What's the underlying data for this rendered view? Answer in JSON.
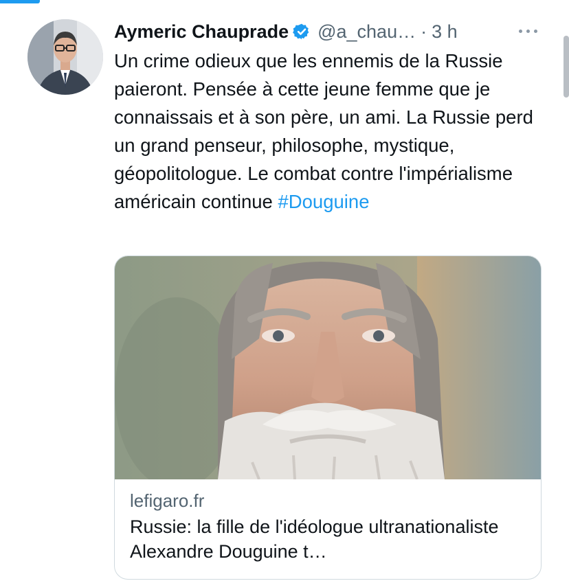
{
  "tweet": {
    "author_name": "Aymeric Chauprade",
    "handle": "@a_chau…",
    "separator": "·",
    "time": "3 h",
    "text_before_hashtag": "Un crime odieux que les ennemis de la Russie paieront. Pensée à cette jeune femme que je connaissais et à son père, un ami. La Russie perd un grand penseur, philosophe, mystique, géopolitologue. Le combat contre l'impérialisme américain continue ",
    "hashtag": "#Douguine"
  },
  "link_card": {
    "domain": "lefigaro.fr",
    "title": "Russie: la fille de l'idéologue ultranationaliste Alexandre Douguine t…"
  },
  "icons": {
    "verified": "verified-badge-icon",
    "more": "more-options-icon"
  },
  "colors": {
    "accent": "#1d9bf0",
    "text_primary": "#0f1419",
    "text_secondary": "#536471",
    "border": "#cfd9de"
  }
}
